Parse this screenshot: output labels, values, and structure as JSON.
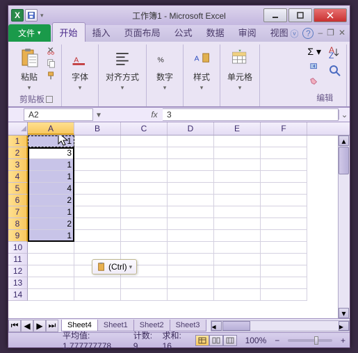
{
  "title": "工作簿1 - Microsoft Excel",
  "tabs": {
    "file": "文件",
    "home": "开始",
    "insert": "插入",
    "layout": "页面布局",
    "formulas": "公式",
    "data": "数据",
    "review": "审阅",
    "view": "视图"
  },
  "ribbon": {
    "paste": "粘贴",
    "clipboard": "剪贴板",
    "font": "字体",
    "alignment": "对齐方式",
    "number": "数字",
    "styles": "样式",
    "cells": "单元格",
    "editing": "编辑"
  },
  "namebox": "A2",
  "formula": "3",
  "fx": "fx",
  "columns": [
    "A",
    "B",
    "C",
    "D",
    "E",
    "F"
  ],
  "rows": [
    "1",
    "2",
    "3",
    "4",
    "5",
    "6",
    "7",
    "8",
    "9",
    "10",
    "11",
    "12",
    "13",
    "14"
  ],
  "cellsA": [
    "1",
    "3",
    "1",
    "1",
    "4",
    "2",
    "1",
    "2",
    "1"
  ],
  "paste_popup": "(Ctrl)",
  "sheets": {
    "nav": [
      "⏮",
      "◀",
      "▶",
      "⏭"
    ],
    "list": [
      "Sheet4",
      "Sheet1",
      "Sheet2",
      "Sheet3"
    ]
  },
  "status": {
    "avg_label": "平均值:",
    "avg_value": "1.777777778",
    "count_label": "计数:",
    "count_value": "9",
    "sum_label": "求和:",
    "sum_value": "16",
    "zoom": "100%"
  }
}
